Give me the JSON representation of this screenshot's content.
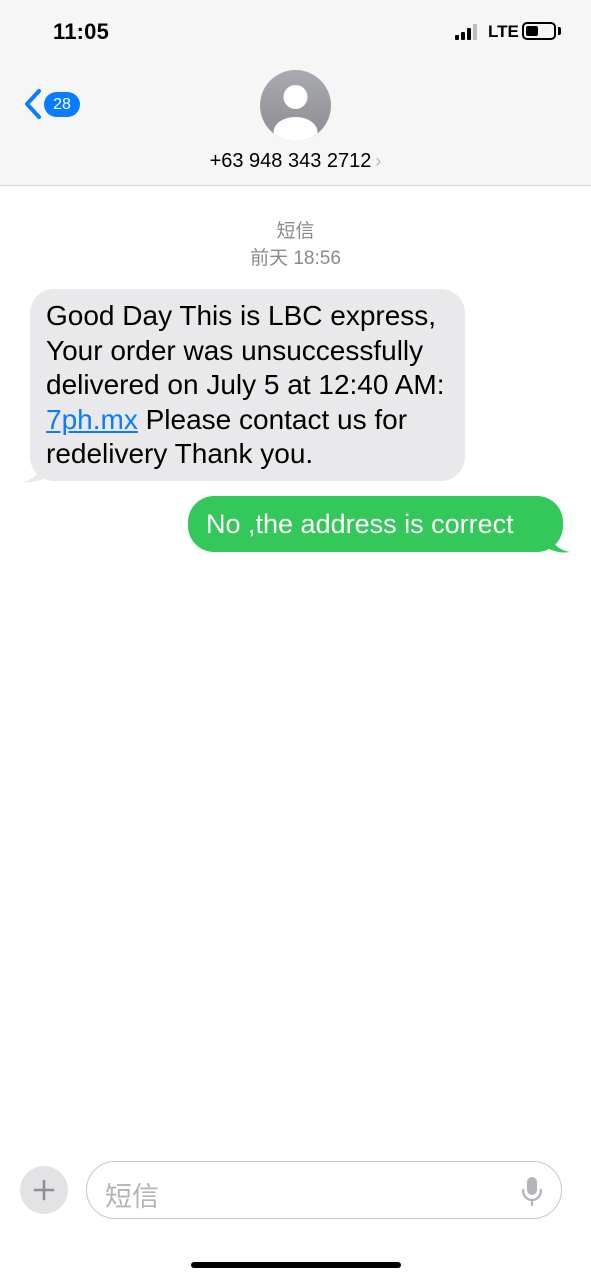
{
  "status_bar": {
    "time": "11:05",
    "network": "LTE",
    "battery_level": 0.45
  },
  "nav": {
    "back_badge_count": "28",
    "contact_number": "+63 948 343 2712",
    "chevron": "›"
  },
  "thread": {
    "service_label": "短信",
    "timestamp": "前天 18:56",
    "messages": [
      {
        "direction": "incoming",
        "text_before_link": "Good Day This is LBC express, Your order was unsuccessfully delivered on July 5 at 12:40 AM: ",
        "link": "7ph.mx",
        "text_after_link": " Please contact us for redelivery Thank you."
      },
      {
        "direction": "outgoing",
        "text": "No ,the address is correct"
      }
    ]
  },
  "composer": {
    "placeholder": "短信"
  },
  "colors": {
    "incoming_bubble": "#e9e9eb",
    "outgoing_bubble": "#34c759",
    "link": "#0a7cff",
    "badge": "#0a7cff"
  }
}
